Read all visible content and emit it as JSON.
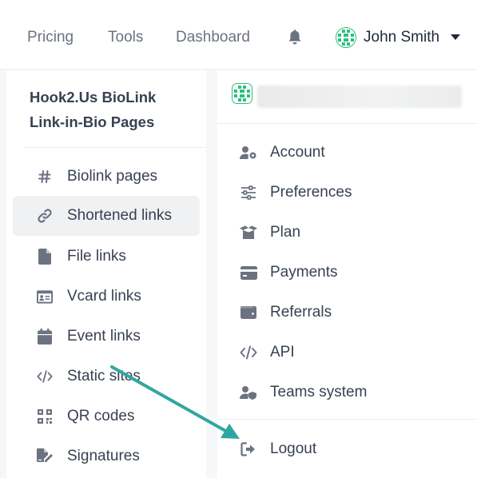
{
  "topnav": {
    "links": [
      "Pricing",
      "Tools",
      "Dashboard"
    ],
    "user_name": "John Smith"
  },
  "sidebar": {
    "brand_line1": "Hook2.Us BioLink",
    "brand_line2": "Link-in-Bio Pages",
    "items": [
      {
        "label": "Biolink pages",
        "icon": "hash-icon",
        "active": false
      },
      {
        "label": "Shortened links",
        "icon": "link-icon",
        "active": true
      },
      {
        "label": "File links",
        "icon": "file-icon",
        "active": false
      },
      {
        "label": "Vcard links",
        "icon": "id-card-icon",
        "active": false
      },
      {
        "label": "Event links",
        "icon": "calendar-icon",
        "active": false
      },
      {
        "label": "Static sites",
        "icon": "code-icon",
        "active": false
      },
      {
        "label": "QR codes",
        "icon": "qrcode-icon",
        "active": false
      },
      {
        "label": "Signatures",
        "icon": "file-signature-icon",
        "active": false
      }
    ]
  },
  "dropdown": {
    "items": [
      {
        "label": "Account",
        "icon": "user-cog-icon"
      },
      {
        "label": "Preferences",
        "icon": "sliders-icon"
      },
      {
        "label": "Plan",
        "icon": "box-open-icon"
      },
      {
        "label": "Payments",
        "icon": "credit-card-icon"
      },
      {
        "label": "Referrals",
        "icon": "wallet-icon"
      },
      {
        "label": "API",
        "icon": "code-icon"
      },
      {
        "label": "Teams system",
        "icon": "user-shield-icon"
      }
    ],
    "logout_label": "Logout"
  },
  "colors": {
    "accent_arrow": "#2fa7a0",
    "avatar_green": "#2ebf7e",
    "icon_gray": "#6b7280"
  }
}
